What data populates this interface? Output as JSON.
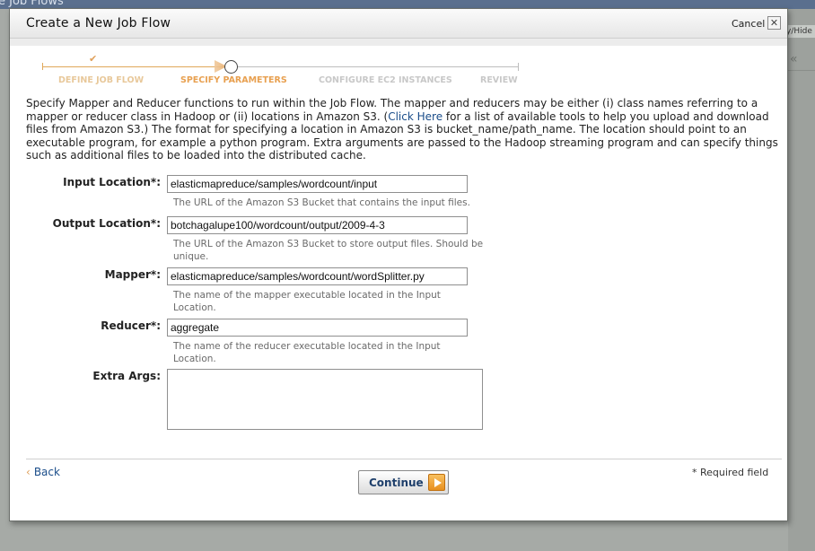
{
  "background": {
    "window_title": "e Job Flows",
    "show_hide_label": "y/Hide"
  },
  "modal": {
    "title": "Create a New Job Flow",
    "cancel_label": "Cancel",
    "close_glyph": "✕"
  },
  "progress": {
    "steps": [
      {
        "label": "DEFINE JOB FLOW",
        "state": "done"
      },
      {
        "label": "SPECIFY PARAMETERS",
        "state": "current"
      },
      {
        "label": "CONFIGURE EC2 INSTANCES",
        "state": "todo"
      },
      {
        "label": "REVIEW",
        "state": "todo"
      }
    ]
  },
  "intro": {
    "before_link": "Specify Mapper and Reducer functions to run within the Job Flow. The mapper and reducers may be either (i) class names referring to a mapper or reducer class in Hadoop or (ii) locations in Amazon S3. (",
    "link": "Click Here",
    "after_link": " for a list of available tools to help you upload and download files from Amazon S3.) The format for specifying a location in Amazon S3 is bucket_name/path_name. The location should point to an executable program, for example a python program. Extra arguments are passed to the Hadoop streaming program and can specify things such as additional files to be loaded into the distributed cache."
  },
  "form": {
    "input_location": {
      "label": "Input Location*:",
      "value": "elasticmapreduce/samples/wordcount/input",
      "help": "The URL of the Amazon S3 Bucket that contains the input files."
    },
    "output_location": {
      "label": "Output Location*:",
      "value": "botchagalupe100/wordcount/output/2009-4-3",
      "help": "The URL of the Amazon S3 Bucket to store output files. Should be unique."
    },
    "mapper": {
      "label": "Mapper*:",
      "value": "elasticmapreduce/samples/wordcount/wordSplitter.py",
      "help": "The name of the mapper executable located in the Input Location."
    },
    "reducer": {
      "label": "Reducer*:",
      "value": "aggregate",
      "help": "The name of the reducer executable located in the Input Location."
    },
    "extra_args": {
      "label": "Extra Args:",
      "value": ""
    }
  },
  "footer": {
    "back_chevron": "‹",
    "back_label": "Back",
    "continue_label": "Continue",
    "required_note": "* Required field"
  },
  "colors": {
    "accent_orange": "#e8a050",
    "link_blue": "#1a4d8a"
  }
}
